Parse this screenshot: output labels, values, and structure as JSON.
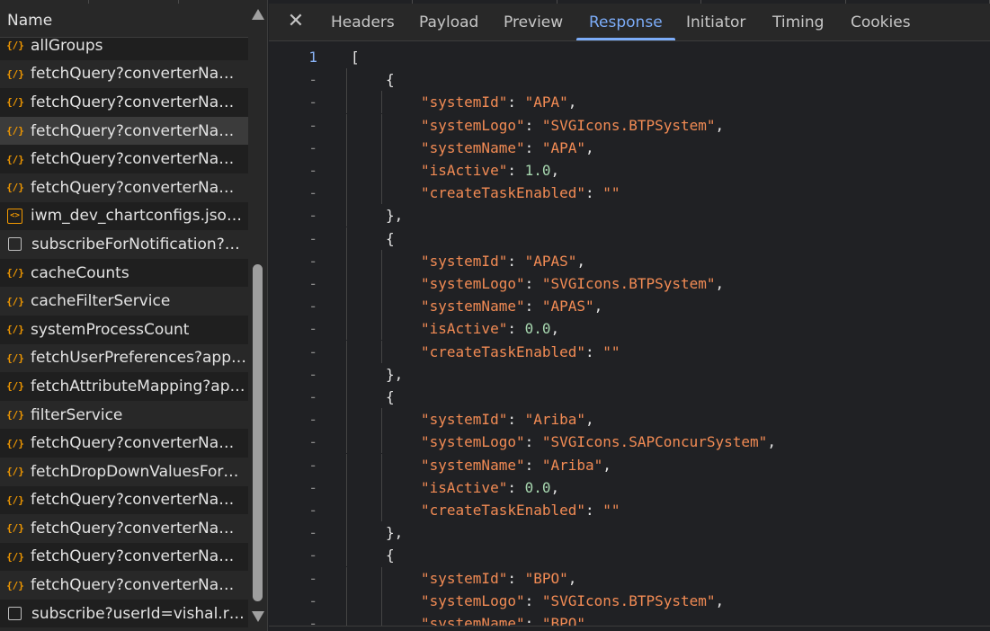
{
  "network": {
    "column_header": "Name",
    "requests": [
      {
        "icon": "json-icon",
        "name": "allGroups",
        "style": "alt"
      },
      {
        "icon": "json-icon",
        "name": "fetchQuery?converterName...",
        "style": ""
      },
      {
        "icon": "json-icon",
        "name": "fetchQuery?converterName...",
        "style": "alt"
      },
      {
        "icon": "json-icon",
        "name": "fetchQuery?converterName...",
        "style": "sel"
      },
      {
        "icon": "json-icon",
        "name": "fetchQuery?converterName...",
        "style": "alt"
      },
      {
        "icon": "json-icon",
        "name": "fetchQuery?converterName...",
        "style": ""
      },
      {
        "icon": "doc-icon",
        "name": "iwm_dev_chartconfigs.json?...",
        "style": "alt"
      },
      {
        "icon": "checkbox-icon",
        "name": "subscribeForNotification?us...",
        "style": ""
      },
      {
        "icon": "json-icon",
        "name": "cacheCounts",
        "style": "alt"
      },
      {
        "icon": "json-icon",
        "name": "cacheFilterService",
        "style": ""
      },
      {
        "icon": "json-icon",
        "name": "systemProcessCount",
        "style": "alt"
      },
      {
        "icon": "json-icon",
        "name": "fetchUserPreferences?appli...",
        "style": ""
      },
      {
        "icon": "json-icon",
        "name": "fetchAttributeMapping?app...",
        "style": "alt"
      },
      {
        "icon": "json-icon",
        "name": "filterService",
        "style": ""
      },
      {
        "icon": "json-icon",
        "name": "fetchQuery?converterName...",
        "style": "alt"
      },
      {
        "icon": "json-icon",
        "name": "fetchDropDownValuesForAt...",
        "style": ""
      },
      {
        "icon": "json-icon",
        "name": "fetchQuery?converterName...",
        "style": "alt"
      },
      {
        "icon": "json-icon",
        "name": "fetchQuery?converterName...",
        "style": ""
      },
      {
        "icon": "json-icon",
        "name": "fetchQuery?converterName...",
        "style": "alt"
      },
      {
        "icon": "json-icon",
        "name": "fetchQuery?converterName...",
        "style": ""
      },
      {
        "icon": "checkbox-icon",
        "name": "subscribe?userId=vishal.r@i...",
        "style": "alt"
      }
    ]
  },
  "detail": {
    "tabs": [
      "Headers",
      "Payload",
      "Preview",
      "Response",
      "Initiator",
      "Timing",
      "Cookies"
    ],
    "active_tab": "Response",
    "first_line_number": "1",
    "folded_marker": "-",
    "lines": [
      {
        "indent": 0,
        "parts": [
          [
            "p",
            "["
          ]
        ]
      },
      {
        "indent": 1,
        "parts": [
          [
            "p",
            "{"
          ]
        ]
      },
      {
        "indent": 2,
        "parts": [
          [
            "k",
            "\"systemId\""
          ],
          [
            "p",
            ": "
          ],
          [
            "s",
            "\"APA\""
          ],
          [
            "p",
            ","
          ]
        ]
      },
      {
        "indent": 2,
        "parts": [
          [
            "k",
            "\"systemLogo\""
          ],
          [
            "p",
            ": "
          ],
          [
            "s",
            "\"SVGIcons.BTPSystem\""
          ],
          [
            "p",
            ","
          ]
        ]
      },
      {
        "indent": 2,
        "parts": [
          [
            "k",
            "\"systemName\""
          ],
          [
            "p",
            ": "
          ],
          [
            "s",
            "\"APA\""
          ],
          [
            "p",
            ","
          ]
        ]
      },
      {
        "indent": 2,
        "parts": [
          [
            "k",
            "\"isActive\""
          ],
          [
            "p",
            ": "
          ],
          [
            "n",
            "1.0"
          ],
          [
            "p",
            ","
          ]
        ]
      },
      {
        "indent": 2,
        "parts": [
          [
            "k",
            "\"createTaskEnabled\""
          ],
          [
            "p",
            ": "
          ],
          [
            "s",
            "\"\""
          ]
        ]
      },
      {
        "indent": 1,
        "parts": [
          [
            "p",
            "},"
          ]
        ]
      },
      {
        "indent": 1,
        "parts": [
          [
            "p",
            "{"
          ]
        ]
      },
      {
        "indent": 2,
        "parts": [
          [
            "k",
            "\"systemId\""
          ],
          [
            "p",
            ": "
          ],
          [
            "s",
            "\"APAS\""
          ],
          [
            "p",
            ","
          ]
        ]
      },
      {
        "indent": 2,
        "parts": [
          [
            "k",
            "\"systemLogo\""
          ],
          [
            "p",
            ": "
          ],
          [
            "s",
            "\"SVGIcons.BTPSystem\""
          ],
          [
            "p",
            ","
          ]
        ]
      },
      {
        "indent": 2,
        "parts": [
          [
            "k",
            "\"systemName\""
          ],
          [
            "p",
            ": "
          ],
          [
            "s",
            "\"APAS\""
          ],
          [
            "p",
            ","
          ]
        ]
      },
      {
        "indent": 2,
        "parts": [
          [
            "k",
            "\"isActive\""
          ],
          [
            "p",
            ": "
          ],
          [
            "n",
            "0.0"
          ],
          [
            "p",
            ","
          ]
        ]
      },
      {
        "indent": 2,
        "parts": [
          [
            "k",
            "\"createTaskEnabled\""
          ],
          [
            "p",
            ": "
          ],
          [
            "s",
            "\"\""
          ]
        ]
      },
      {
        "indent": 1,
        "parts": [
          [
            "p",
            "},"
          ]
        ]
      },
      {
        "indent": 1,
        "parts": [
          [
            "p",
            "{"
          ]
        ]
      },
      {
        "indent": 2,
        "parts": [
          [
            "k",
            "\"systemId\""
          ],
          [
            "p",
            ": "
          ],
          [
            "s",
            "\"Ariba\""
          ],
          [
            "p",
            ","
          ]
        ]
      },
      {
        "indent": 2,
        "parts": [
          [
            "k",
            "\"systemLogo\""
          ],
          [
            "p",
            ": "
          ],
          [
            "s",
            "\"SVGIcons.SAPConcurSystem\""
          ],
          [
            "p",
            ","
          ]
        ]
      },
      {
        "indent": 2,
        "parts": [
          [
            "k",
            "\"systemName\""
          ],
          [
            "p",
            ": "
          ],
          [
            "s",
            "\"Ariba\""
          ],
          [
            "p",
            ","
          ]
        ]
      },
      {
        "indent": 2,
        "parts": [
          [
            "k",
            "\"isActive\""
          ],
          [
            "p",
            ": "
          ],
          [
            "n",
            "0.0"
          ],
          [
            "p",
            ","
          ]
        ]
      },
      {
        "indent": 2,
        "parts": [
          [
            "k",
            "\"createTaskEnabled\""
          ],
          [
            "p",
            ": "
          ],
          [
            "s",
            "\"\""
          ]
        ]
      },
      {
        "indent": 1,
        "parts": [
          [
            "p",
            "},"
          ]
        ]
      },
      {
        "indent": 1,
        "parts": [
          [
            "p",
            "{"
          ]
        ]
      },
      {
        "indent": 2,
        "parts": [
          [
            "k",
            "\"systemId\""
          ],
          [
            "p",
            ": "
          ],
          [
            "s",
            "\"BPO\""
          ],
          [
            "p",
            ","
          ]
        ]
      },
      {
        "indent": 2,
        "parts": [
          [
            "k",
            "\"systemLogo\""
          ],
          [
            "p",
            ": "
          ],
          [
            "s",
            "\"SVGIcons.BTPSystem\""
          ],
          [
            "p",
            ","
          ]
        ]
      },
      {
        "indent": 2,
        "parts": [
          [
            "k",
            "\"systemName\""
          ],
          [
            "p",
            ": "
          ],
          [
            "s",
            "\"BPO\""
          ],
          [
            "p",
            ","
          ]
        ]
      }
    ]
  },
  "colors": {
    "accent": "#7cacf8",
    "key": "#f28b54",
    "number": "#a8d8b0",
    "json_icon": "#f29900"
  }
}
